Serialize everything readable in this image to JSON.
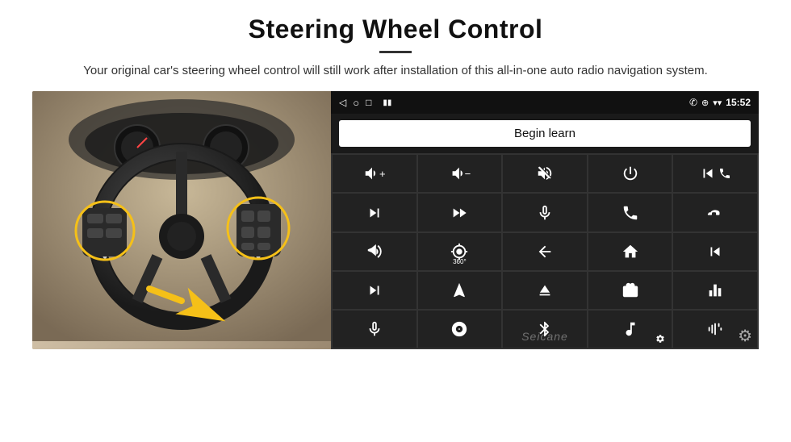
{
  "header": {
    "title": "Steering Wheel Control",
    "subtitle": "Your original car's steering wheel control will still work after installation of this all-in-one auto radio navigation system."
  },
  "status_bar": {
    "nav_back": "◁",
    "nav_home": "○",
    "nav_square": "□",
    "signal": "▮▮",
    "phone_icon": "✆",
    "location": "⊕",
    "wifi": "▾",
    "time": "15:52"
  },
  "begin_learn_btn": "Begin learn",
  "controls": [
    {
      "icon": "vol-up",
      "unicode": "🔊+"
    },
    {
      "icon": "vol-down",
      "unicode": "🔉-"
    },
    {
      "icon": "vol-mute",
      "unicode": "🔇"
    },
    {
      "icon": "power",
      "unicode": "⏻"
    },
    {
      "icon": "prev-track-phone",
      "unicode": "✆⏮"
    },
    {
      "icon": "next-track",
      "unicode": "⏭"
    },
    {
      "icon": "fast-forward-mute",
      "unicode": "⏩"
    },
    {
      "icon": "mic",
      "unicode": "🎤"
    },
    {
      "icon": "phone",
      "unicode": "📞"
    },
    {
      "icon": "hang-up",
      "unicode": "📵"
    },
    {
      "icon": "horn",
      "unicode": "📯"
    },
    {
      "icon": "360",
      "unicode": "360°"
    },
    {
      "icon": "back",
      "unicode": "↩"
    },
    {
      "icon": "home",
      "unicode": "⌂"
    },
    {
      "icon": "skip-back",
      "unicode": "⏮"
    },
    {
      "icon": "skip-forward",
      "unicode": "⏭"
    },
    {
      "icon": "navigate",
      "unicode": "➤"
    },
    {
      "icon": "eject",
      "unicode": "⏏"
    },
    {
      "icon": "radio",
      "unicode": "📻"
    },
    {
      "icon": "equalizer",
      "unicode": "≡↕"
    },
    {
      "icon": "mic2",
      "unicode": "🎤"
    },
    {
      "icon": "cd",
      "unicode": "💿"
    },
    {
      "icon": "bluetooth",
      "unicode": "⚡"
    },
    {
      "icon": "music",
      "unicode": "♪⚙"
    },
    {
      "icon": "soundwave",
      "unicode": "▐▌▐"
    }
  ],
  "watermark": "Seicane",
  "gear_icon": "⚙"
}
